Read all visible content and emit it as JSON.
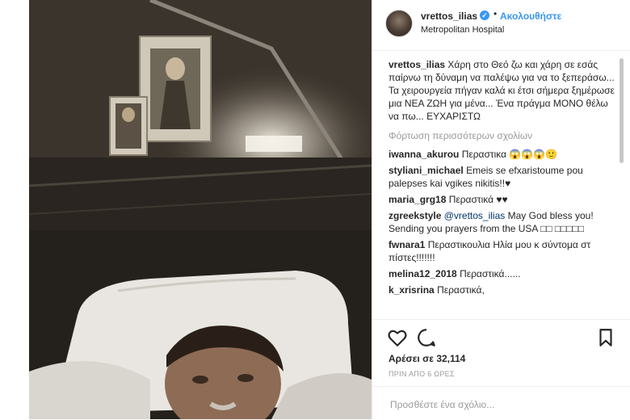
{
  "post": {
    "username": "vrettos_ilias",
    "follow_label": "Ακολουθήστε",
    "location": "Metropolitan Hospital",
    "caption_user": "vrettos_ilias",
    "caption_text": "Χάρη στο Θεό ζω και χάρη σε εσάς παίρνω τη δύναμη να παλέψω για να το ξεπεράσω... Τα χειρουργεία πήγαν καλά κι έτσι σήμερα ξημέρωσε μια ΝΕΑ ΖΩΗ για μένα... Ένα πράγμα ΜΟΝΟ θέλω να πω... ΕΥΧΑΡΙΣΤΩ",
    "load_more": "Φόρτωση περισσότερων σχολίων",
    "likes": "Αρέσει σε 32,114",
    "time": "ΠΡΙΝ ΑΠΟ 6 ΩΡΕΣ",
    "add_comment_placeholder": "Προσθέστε ένα σχόλιο...",
    "verified_color": "#3897f0",
    "link_color": "#3897f0"
  },
  "comments": [
    {
      "user": "iwanna_akurou",
      "text": "Περαστικα 😱😱😱🙂"
    },
    {
      "user": "styliani_michael",
      "text": "Emeis se efxaristoume pou palepses kai vgikes nikitis!!♥"
    },
    {
      "user": "maria_grg18",
      "text": "Περαστικά ♥♥"
    },
    {
      "user": "zgreekstyle",
      "mention": "@vrettos_ilias",
      "text": "May God bless you! Sending you prayers from the USA □□ □□□□□"
    },
    {
      "user": "fwnara1",
      "text": "Περαστικουλια Ηλία μου κ σύντομα στ πίστες!!!!!!!"
    },
    {
      "user": "melina12_2018",
      "text": "Περαστικά......"
    },
    {
      "user": "k_xrisrina",
      "text": "Περαστικά,"
    }
  ],
  "icons": {
    "heart": "heart-icon",
    "comment": "comment-icon",
    "bookmark": "bookmark-icon",
    "verified": "verified-badge-icon"
  }
}
